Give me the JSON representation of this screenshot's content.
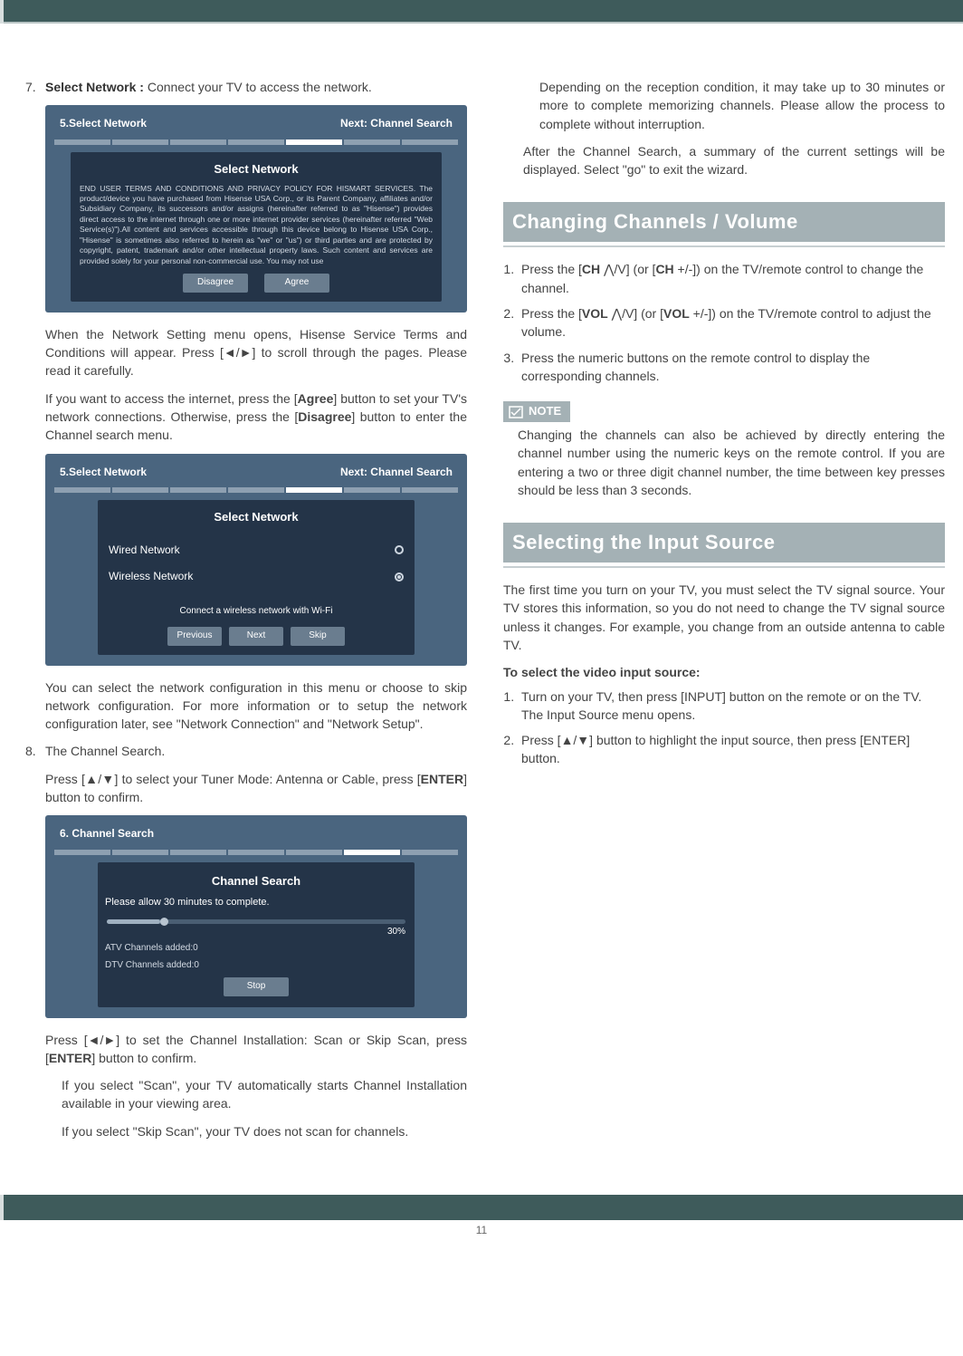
{
  "step7": {
    "num": "7.",
    "label": "Select Network :",
    "text": " Connect your TV to access the network."
  },
  "panel1": {
    "left": "5.Select Network",
    "right": "Next: Channel Search",
    "title": "Select Network",
    "terms": "END USER TERMS AND CONDITIONS AND PRIVACY POLICY FOR HISMART SERVICES. The product/device you have purchased from Hisense USA Corp., or its Parent Company, affiliates and/or Subsidiary Company, its successors and/or assigns (hereinafter referred to as \"Hisense\") provides direct access to the internet through one or more internet provider services (hereinafter referred \"Web Service(s)\").All content and services accessible through this device belong to Hisense USA Corp., \"Hisense\" is sometimes also referred to herein as \"we\" or \"us\") or third parties and are protected by copyright, patent, trademark and/or other intellectual property laws. Such content and services are provided solely for your personal non-commercial use. You may not use",
    "btnDisagree": "Disagree",
    "btnAgree": "Agree"
  },
  "para1": "When the Network Setting menu opens, Hisense Service Terms and Conditions will appear. Press [◄/►] to scroll through the pages. Please read it carefully.",
  "para2a": "If you want to access the internet, press the [",
  "para2b": "Agree",
  "para2c": "] button to set your TV's network connections. Otherwise, press the [",
  "para2d": "Disagree",
  "para2e": "] button to enter the Channel search menu.",
  "panel2": {
    "left": "5.Select Network",
    "right": "Next: Channel Search",
    "title": "Select Network",
    "wired": "Wired Network",
    "wireless": "Wireless Network",
    "msg": "Connect a wireless network with Wi-Fi",
    "btnPrev": "Previous",
    "btnNext": "Next",
    "btnSkip": "Skip"
  },
  "para3": "You can select the network configuration in this menu or choose to skip network configuration. For more information or to setup the network configuration later, see \"Network Connection\" and \"Network Setup\".",
  "step8": {
    "num": "8.",
    "text": "The Channel Search."
  },
  "para4a": "Press [▲/▼] to select your Tuner Mode: Antenna or Cable, press [",
  "para4b": "ENTER",
  "para4c": "] button to confirm.",
  "panel3": {
    "left": "6. Channel Search",
    "title": "Channel Search",
    "msg": "Please allow 30 minutes to complete.",
    "pct": "30%",
    "atv": "ATV Channels added:0",
    "dtv": "DTV Channels added:0",
    "btnStop": "Stop"
  },
  "para5a": "Press [◄/►] to set the Channel Installation: Scan or Skip Scan, press [",
  "para5b": "ENTER",
  "para5c": "] button to confirm.",
  "para6": "If you select \"Scan\", your TV automatically starts Channel Installation available in your viewing area.",
  "para7": "If you select \"Skip Scan\", your TV does not scan for channels.",
  "para8": "Depending on the reception condition, it may take up to 30 minutes or more to complete memorizing channels. Please allow the process to complete without interruption.",
  "para9": "After the Channel Search, a summary of the current settings will be displayed.  Select \"go\" to exit the wizard.",
  "h2a": "Changing Channels / Volume",
  "cc1a": "Press the [",
  "cc1b": "CH",
  "cc1c": " ⋀/V] (or [",
  "cc1d": "CH",
  "cc1e": " +/-]) on the TV/remote control to change the channel.",
  "cc2a": "Press the [",
  "cc2b": "VOL",
  "cc2c": " ⋀/V] (or [",
  "cc2d": "VOL",
  "cc2e": " +/-]) on the TV/remote control to adjust the volume.",
  "cc3": "Press the numeric buttons on the remote control to display the corresponding channels.",
  "noteLabel": "NOTE",
  "noteBody": "Changing the channels can also be achieved by directly entering the channel number using the numeric keys on the remote control. If you are entering a two or three digit channel number, the time between key presses should be less than 3 seconds.",
  "h2b": "Selecting the Input Source",
  "sis1": "The first time you turn on your TV, you must select the TV signal source. Your TV stores this information, so you do not need to change the TV signal source unless it changes. For example, you change from an outside antenna to cable TV.",
  "sis2": "To select the video input source:",
  "sisL1": "Turn on your TV, then press [INPUT] button on the remote or on the TV. The Input Source menu opens.",
  "sisL2": "Press [▲/▼] button to highlight the input source, then press [ENTER] button.",
  "pageNum": "11"
}
